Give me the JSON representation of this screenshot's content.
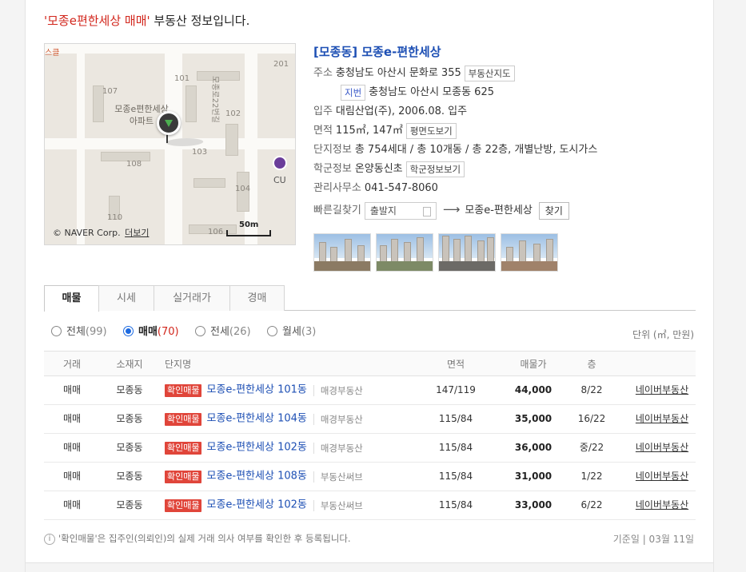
{
  "headline": {
    "quoted": "'모종e편한세상 매매'",
    "rest": " 부동산 정보입니다."
  },
  "map": {
    "labels": [
      "스클",
      "201",
      "107",
      "101",
      "모종로22번길",
      "103",
      "108",
      "104",
      "110",
      "106",
      "102"
    ],
    "apt_label_1": "모종e편한세상",
    "apt_label_2": "아파트",
    "store_label": "CU",
    "copyright": "© NAVER Corp.",
    "more_link": "더보기",
    "scale": "50m"
  },
  "info": {
    "name": "[모종동] 모종e-편한세상",
    "address_key": "주소",
    "address": "충청남도 아산시 문화로 355",
    "map_btn": "부동산지도",
    "jibun_label": "지번",
    "jibun": "충청남도 아산시 모종동 625",
    "move_key": "입주",
    "move": "대림산업(주), 2006.08. 입주",
    "area_key": "면적",
    "area": "115㎡, 147㎡",
    "floorplan_btn": "평면도보기",
    "complex_key": "단지정보",
    "complex": "총 754세대 / 총 10개동 / 총 22층, 개별난방, 도시가스",
    "school_key": "학군정보",
    "school": "온양동신초",
    "school_btn": "학군정보보기",
    "office_key": "관리사무소",
    "office": "041-547-8060",
    "route_key": "빠른길찾기",
    "route_start": "출발지",
    "route_arrow": "⟶",
    "route_dest": "모종e-편한세상",
    "find_btn": "찾기"
  },
  "tabs": [
    "매물",
    "시세",
    "실거래가",
    "경매"
  ],
  "filters": [
    {
      "label": "전체",
      "count": "(99)"
    },
    {
      "label": "매매",
      "count": "(70)"
    },
    {
      "label": "전세",
      "count": "(26)"
    },
    {
      "label": "월세",
      "count": "(3)"
    }
  ],
  "selected_filter": "매매",
  "unit": "단위 (㎡, 만원)",
  "table": {
    "headers": {
      "deal": "거래",
      "loc": "소재지",
      "name": "단지명",
      "area": "면적",
      "price": "매물가",
      "floor": "층"
    },
    "badge": "확인매물",
    "rows": [
      {
        "deal": "매매",
        "loc": "모종동",
        "name": "모종e-편한세상 101동",
        "agency": "매경부동산",
        "area": "147/119",
        "price": "44,000",
        "floor": "8/22",
        "agent": "네이버부동산"
      },
      {
        "deal": "매매",
        "loc": "모종동",
        "name": "모종e-편한세상 104동",
        "agency": "매경부동산",
        "area": "115/84",
        "price": "35,000",
        "floor": "16/22",
        "agent": "네이버부동산"
      },
      {
        "deal": "매매",
        "loc": "모종동",
        "name": "모종e-편한세상 102동",
        "agency": "매경부동산",
        "area": "115/84",
        "price": "36,000",
        "floor": "중/22",
        "agent": "네이버부동산"
      },
      {
        "deal": "매매",
        "loc": "모종동",
        "name": "모종e-편한세상 108동",
        "agency": "부동산써브",
        "area": "115/84",
        "price": "31,000",
        "floor": "1/22",
        "agent": "네이버부동산"
      },
      {
        "deal": "매매",
        "loc": "모종동",
        "name": "모종e-편한세상 102동",
        "agency": "부동산써브",
        "area": "115/84",
        "price": "33,000",
        "floor": "6/22",
        "agent": "네이버부동산"
      }
    ]
  },
  "note": "'확인매물'은 집주인(의뢰인)의 실제 거래 의사 여부를 확인한 후 등록됩니다.",
  "date": "기준일 | 03월 11일",
  "colors": {
    "accent_red": "#d2261c",
    "link_blue": "#1d4fb4",
    "radio_blue": "#1d6ae0",
    "badge_red": "#e0453a"
  }
}
